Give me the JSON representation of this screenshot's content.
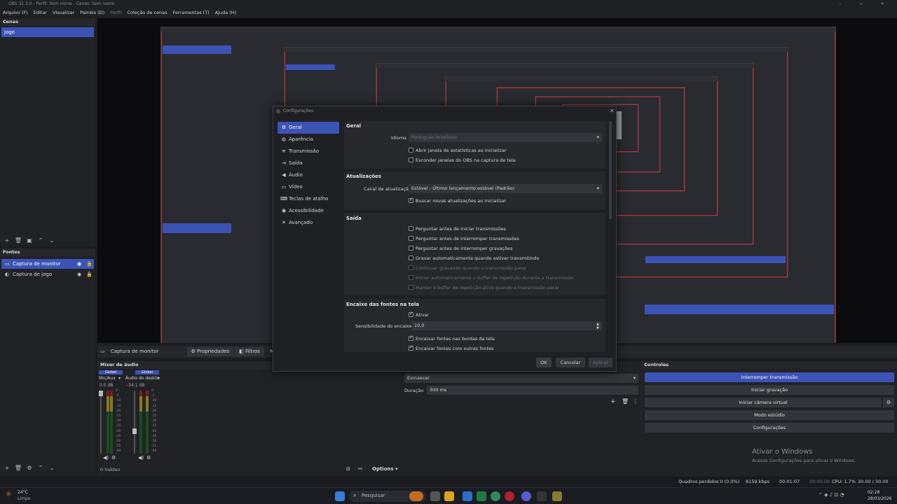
{
  "window": {
    "title": "OBS 32.3.0 - Perfil: Sem nome - Cenas: Sem nome"
  },
  "menu": [
    "Arquivo (F)",
    "Editar",
    "Visualizar",
    "Painéis (D)",
    "Perfil",
    "Coleção de cenas",
    "Ferramentas (T)",
    "Ajuda (H)"
  ],
  "scenes": {
    "title": "Cenas",
    "items": [
      "jogo"
    ]
  },
  "sources": {
    "title": "Fontes",
    "items": [
      "Captura de monitor",
      "Captura de jogo"
    ]
  },
  "context": {
    "source": "Captura de monitor",
    "properties": "Propriedades",
    "filters": "Filtros",
    "monitor": "Monitor"
  },
  "mixer": {
    "title": "Mixer de áudio",
    "tracks": [
      {
        "badge": "Global",
        "name": "Mic/Aux",
        "db": "0.0 dB"
      },
      {
        "badge": "Global",
        "name": "Áudio do deskto",
        "db": "-34.1 dB"
      }
    ],
    "ticks": [
      "0",
      "-5",
      "-10",
      "-15",
      "-20",
      "-25",
      "-30",
      "-35",
      "-40",
      "-45",
      "-50",
      "-55",
      "-60"
    ],
    "hidden": "0 hidden"
  },
  "transitions": {
    "type": "Esmaecer",
    "duration_label": "Duração",
    "duration": "300 ms",
    "options": "Options"
  },
  "controls": {
    "title": "Controles",
    "buttons": [
      "Interromper transmissão",
      "Iniciar gravação",
      "Iniciar câmera virtual",
      "Modo estúdio",
      "Configurações"
    ]
  },
  "watermark": {
    "line1": "Ativar o Windows",
    "line2": "Acesse Configurações para ativar o Windows."
  },
  "status": {
    "dropped": "Quadros perdidos 0 (0.0%)",
    "bitrate": "8159 kbps",
    "stream_time": "00:01:07",
    "rec_time": "00:00:00",
    "cpu": "CPU: 1.7%",
    "fps": "30.00 / 30.00 FPS"
  },
  "taskbar": {
    "temp": "24°C",
    "weather": "Limpo",
    "search": "Pesquisar",
    "time": "02:28",
    "date": "28/03/2026"
  },
  "dialog": {
    "title": "Configurações",
    "nav": [
      {
        "label": "Geral",
        "icon": "⚙"
      },
      {
        "label": "Aparência",
        "icon": "◍"
      },
      {
        "label": "Transmissão",
        "icon": "≋"
      },
      {
        "label": "Saída",
        "icon": "⇥"
      },
      {
        "label": "Áudio",
        "icon": "◀"
      },
      {
        "label": "Vídeo",
        "icon": "▭"
      },
      {
        "label": "Teclas de atalho",
        "icon": "⌨"
      },
      {
        "label": "Acessibilidade",
        "icon": "◉"
      },
      {
        "label": "Avançado",
        "icon": "✕"
      }
    ],
    "geral": {
      "title": "Geral",
      "language_label": "Idioma",
      "language": "Português brasileiro",
      "opt1": "Abrir janela de estatísticas ao inicializar",
      "opt2": "Esconder janelas do OBS na captura de tela"
    },
    "updates": {
      "title": "Atualizações",
      "channel_label": "Canal de atualização",
      "channel": "Estável - Último lançamento estável (Padrão)",
      "check": "Buscar novas atualizações ao inicializar"
    },
    "output": {
      "title": "Saída",
      "items": [
        "Perguntar antes de iniciar transmissões",
        "Perguntar antes de interromper transmissões",
        "Perguntar antes de interromper gravações",
        "Gravar automaticamente quando estiver transmitindo",
        "Continuar gravando quando a transmissão parar",
        "Iniciar automaticamente o buffer de repetição durante a transmissão",
        "Manter o buffer de repetição ativo quando a transmissão parar"
      ]
    },
    "snap": {
      "title": "Encaixe das fontes na tela",
      "enable": "Ativar",
      "sensitivity_label": "Sensibilidade do encaixe",
      "sensitivity": "10,0",
      "edges": "Encaixar fontes nas bordas da tela",
      "others": "Encaixar fontes com outras fontes"
    },
    "buttons": {
      "ok": "OK",
      "cancel": "Cancelar",
      "apply": "Aplicar"
    }
  }
}
